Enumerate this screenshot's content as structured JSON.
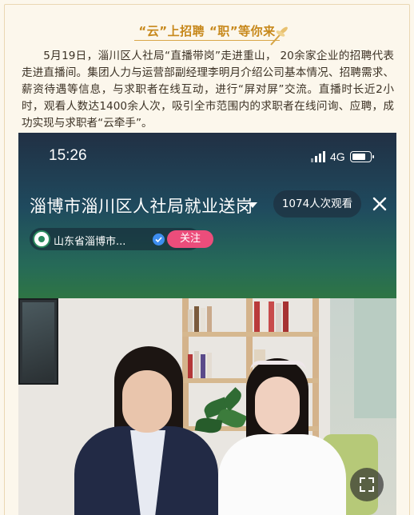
{
  "article": {
    "heading": "“云”上招聘 “职”等你来",
    "intro": "5月19日，淄川区人社局“直播带岗”走进重山， 20余家企业的招聘代表走进直播间。集团人力与运营部副经理李明月介绍公司基本情况、招聘需求、薪资待遇等信息，与求职者在线互动，进行“屏对屏”交流。直播时长近2小时，观看人数达1400余人次，吸引全市范围内的求职者在线问询、应聘，成功实现与求职者“云牵手”。"
  },
  "screenshot": {
    "status_bar": {
      "time": "15:26",
      "network": "4G",
      "battery_level": 0.8
    },
    "live_title": "淄博市淄川区人社局就业送岗",
    "viewers": "1074人次观看",
    "channel_name": "山东省淄博市...",
    "follow_label": "关注"
  },
  "colors": {
    "heading": "#c7881b",
    "follow_button": "#ec4d7b",
    "verified_badge": "#3d8ef0"
  },
  "icons": [
    "dragonfly-icon",
    "signal-icon",
    "battery-icon",
    "dropdown-caret-icon",
    "close-icon",
    "verified-icon",
    "fullscreen-icon"
  ]
}
